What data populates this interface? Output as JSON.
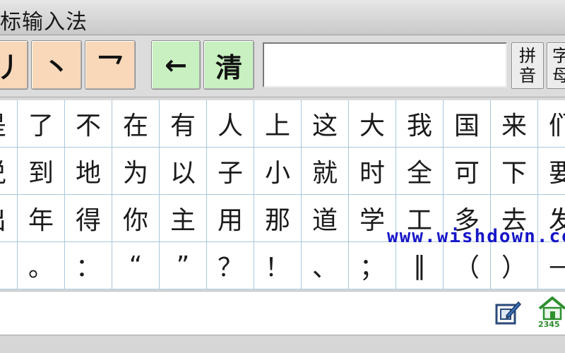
{
  "window": {
    "title": "标输入法"
  },
  "toolbar": {
    "stroke_keys": [
      "丿",
      "丶",
      "乛"
    ],
    "backspace_label": "←",
    "clear_label": "清",
    "input_value": "",
    "pinyin_label": [
      "拼",
      "音"
    ],
    "zimu_label": [
      "字",
      "母"
    ]
  },
  "grid": {
    "rows": [
      [
        "是",
        "了",
        "不",
        "在",
        "有",
        "人",
        "上",
        "这",
        "大",
        "我",
        "国",
        "来",
        "们"
      ],
      [
        "说",
        "到",
        "地",
        "为",
        "以",
        "子",
        "小",
        "就",
        "时",
        "全",
        "可",
        "下",
        "要"
      ],
      [
        "出",
        "年",
        "得",
        "你",
        "主",
        "用",
        "那",
        "道",
        "学",
        "工",
        "多",
        "去",
        "发"
      ],
      [
        "，",
        "。",
        "：",
        "“",
        "”",
        "？",
        "！",
        "、",
        "；",
        "‖",
        "（",
        "）",
        "—"
      ]
    ]
  },
  "watermark": "www.wishdown.com",
  "status": {
    "home_label": "2345"
  },
  "colors": {
    "stroke_key": "#f8d8b8",
    "action_key": "#c8f0c0",
    "grid_line": "#a9c8dc",
    "watermark": "#1616c8"
  }
}
